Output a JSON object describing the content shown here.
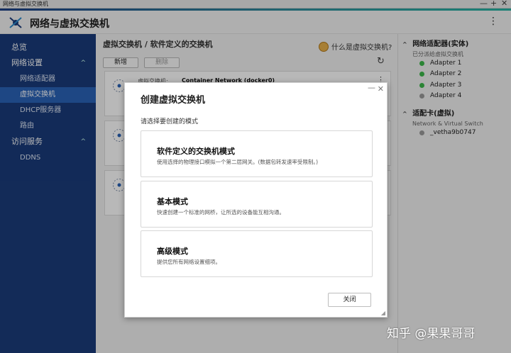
{
  "window": {
    "title": "网络与虚拟交换机",
    "min_glyph": "—",
    "max_glyph": "+",
    "close_glyph": "✕"
  },
  "app": {
    "title": "网络与虚拟交换机",
    "menu_glyph": "⋮"
  },
  "sidebar": {
    "overview": "总览",
    "network_settings": "网络设置",
    "network_adapter": "网络适配器",
    "virtual_switch": "虚拟交换机",
    "dhcp": "DHCP服务器",
    "routing": "路由",
    "access_services": "访问服务",
    "ddns": "DDNS",
    "chevron": "^"
  },
  "main": {
    "breadcrumb": "虚拟交换机 / 软件定义的交换机",
    "help_link": "什么是虚拟交换机?",
    "add_button": "新增",
    "delete_button": "删除",
    "refresh_glyph": "↻",
    "card1": {
      "label": "虚拟交换机:",
      "value": "Container Network (docker0)",
      "more_glyph": "⋮"
    }
  },
  "right_panel": {
    "adapters_title": "网络适配器(实体)",
    "adapters_subtitle": "已分派给虚拟交换机",
    "adapters": [
      {
        "name": "Adapter 1",
        "color": "#3cb84a"
      },
      {
        "name": "Adapter 2",
        "color": "#3cb84a"
      },
      {
        "name": "Adapter 3",
        "color": "#3cb84a"
      },
      {
        "name": "Adapter 4",
        "color": "#9a9a9a"
      }
    ],
    "vnic_title": "适配卡(虚拟)",
    "vnic_subtitle": "Network & Virtual Switch",
    "vnic_item": "_vetha9b0747",
    "vnic_color": "#9a9a9a",
    "chevron": "^"
  },
  "modal": {
    "title": "创建虚拟交换机",
    "subtitle": "请选择要创建的模式",
    "min_glyph": "—",
    "close_glyph": "✕",
    "options": [
      {
        "title": "软件定义的交换机模式",
        "desc": "使用选择的物理接口模拟一个第二层网关。(数据包转发速率受限制。)"
      },
      {
        "title": "基本模式",
        "desc": "快速创建一个标准的网桥，让所选的设备能互相沟通。"
      },
      {
        "title": "高级模式",
        "desc": "提供您所有网络设置细项。"
      }
    ],
    "close_button": "关闭",
    "resize_glyph": "◢"
  },
  "watermark": "知乎 @果果哥哥",
  "colors": {
    "sidebar_bg": "#1a3b7a",
    "sidebar_active": "#2a63b8",
    "accent": "#26b3a2"
  }
}
